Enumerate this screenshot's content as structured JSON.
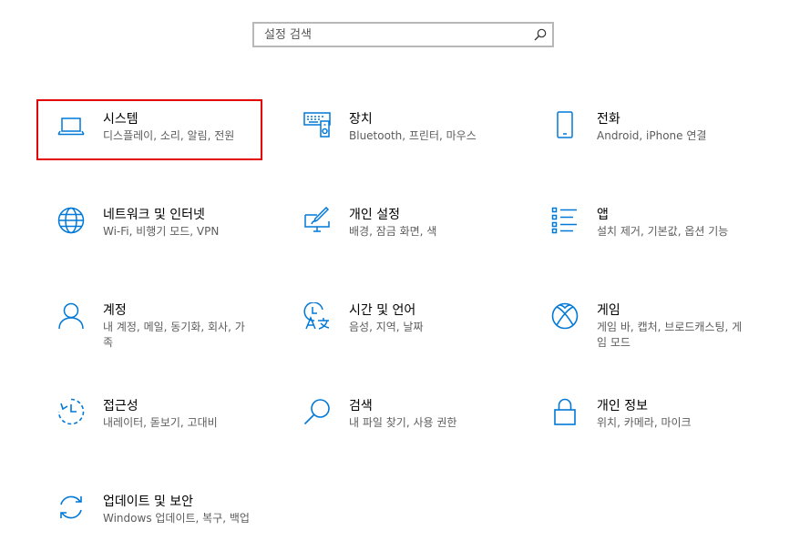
{
  "search": {
    "placeholder": "설정 검색",
    "icon": "search-icon"
  },
  "colors": {
    "accent": "#0078d7",
    "highlight": "#e50000",
    "description": "#5c5c5c"
  },
  "tiles": [
    {
      "title": "시스템",
      "desc": "디스플레이, 소리, 알림, 전원",
      "icon": "laptop-icon"
    },
    {
      "title": "장치",
      "desc": "Bluetooth, 프린터, 마우스",
      "icon": "keyboard-speaker-icon"
    },
    {
      "title": "전화",
      "desc": "Android, iPhone 연결",
      "icon": "phone-icon"
    },
    {
      "title": "네트워크 및 인터넷",
      "desc": "Wi-Fi, 비행기 모드, VPN",
      "icon": "globe-icon"
    },
    {
      "title": "개인 설정",
      "desc": "배경, 잠금 화면, 색",
      "icon": "paintbrush-icon"
    },
    {
      "title": "앱",
      "desc": "설치 제거, 기본값, 옵션 기능",
      "icon": "app-list-icon"
    },
    {
      "title": "계정",
      "desc": "내 계정, 메일, 동기화, 회사, 가족",
      "icon": "person-icon"
    },
    {
      "title": "시간 및 언어",
      "desc": "음성, 지역, 날짜",
      "icon": "time-language-icon"
    },
    {
      "title": "게임",
      "desc": "게임 바, 캡처, 브로드캐스팅, 게임 모드",
      "icon": "xbox-icon"
    },
    {
      "title": "접근성",
      "desc": "내레이터, 돋보기, 고대비",
      "icon": "ease-of-access-icon"
    },
    {
      "title": "검색",
      "desc": "내 파일 찾기, 사용 권한",
      "icon": "search-icon"
    },
    {
      "title": "개인 정보",
      "desc": "위치, 카메라, 마이크",
      "icon": "lock-icon"
    },
    {
      "title": "업데이트 및 보안",
      "desc": "Windows 업데이트, 복구, 백업",
      "icon": "sync-icon"
    }
  ]
}
